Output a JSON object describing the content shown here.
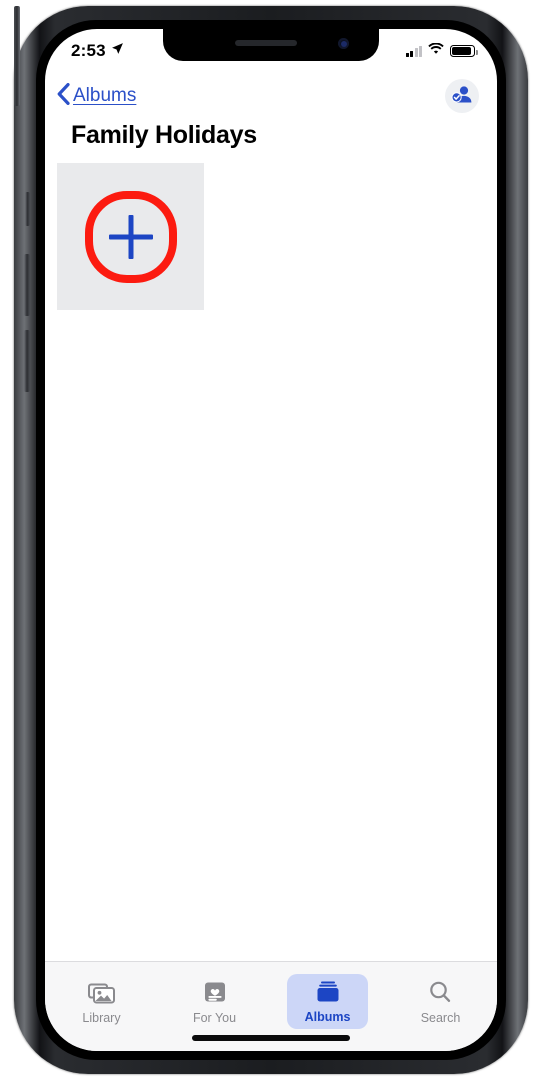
{
  "device": {
    "name": "iphone-x",
    "home_indicator": true
  },
  "status_bar": {
    "time": "2:53",
    "location_icon": "location-arrow-icon",
    "signal_icon": "cellular-signal-icon",
    "signal_bars_filled": 2,
    "signal_bars_total": 4,
    "wifi_icon": "wifi-icon",
    "battery_icon": "battery-icon",
    "battery_level_percent": 95
  },
  "nav_bar": {
    "back_icon": "chevron-left-icon",
    "back_label": "Albums",
    "shared_album_icon": "person-badge-checkmark-icon"
  },
  "page_title": "Family Holidays",
  "grid": {
    "add_tile": {
      "icon": "plus-icon",
      "label": "",
      "annotated": true,
      "annotation_color": "#fc1b10"
    },
    "photos": []
  },
  "tab_bar": {
    "tabs": [
      {
        "label": "Library",
        "icon": "photo-stack-icon",
        "selected": false
      },
      {
        "label": "For You",
        "icon": "heart-card-icon",
        "selected": false
      },
      {
        "label": "Albums",
        "icon": "albums-folder-icon",
        "selected": true
      },
      {
        "label": "Search",
        "icon": "magnifier-icon",
        "selected": false
      }
    ]
  },
  "colors": {
    "accent_blue": "#1c45c4",
    "link_blue": "#2b50c8",
    "tab_selected_bg": "#ccd6f7",
    "tile_gray": "#e9eaec",
    "annotation_red": "#fc1b10",
    "tab_inactive": "#8a8a8e"
  }
}
